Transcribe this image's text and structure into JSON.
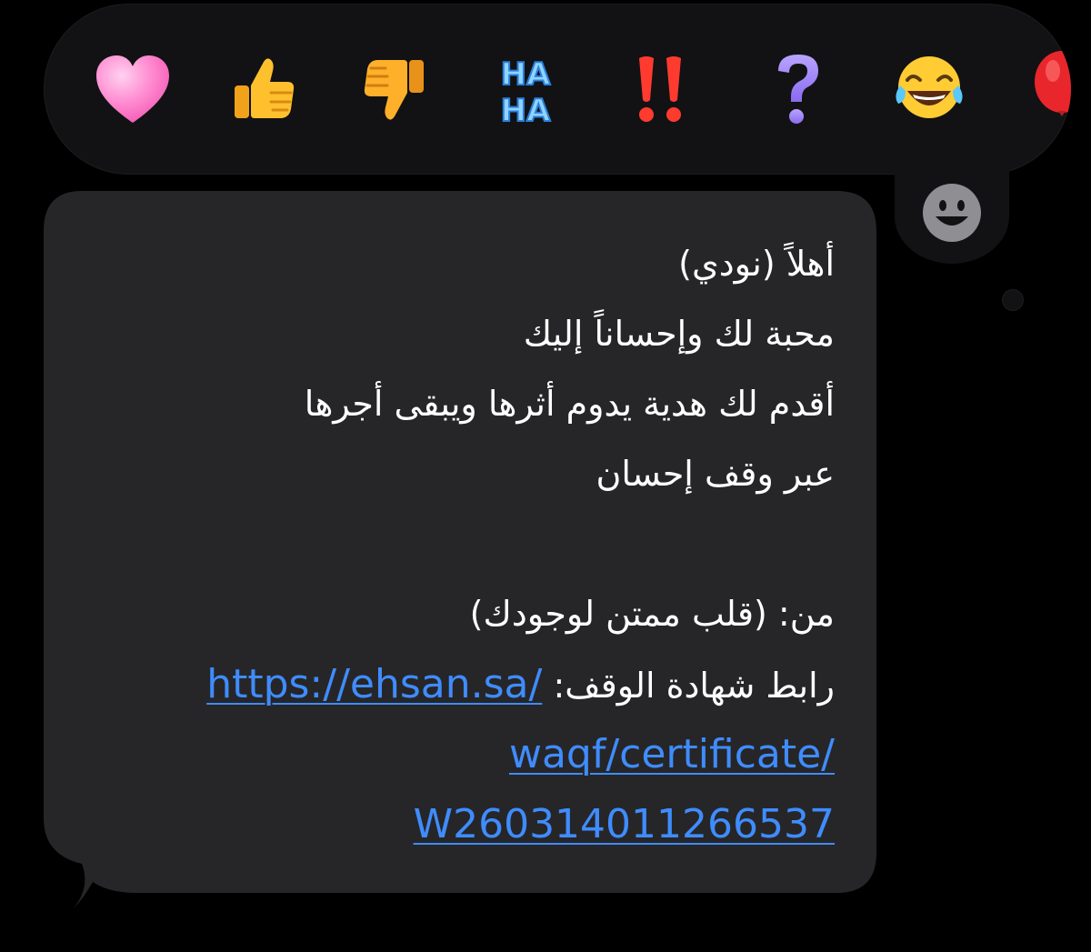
{
  "message": {
    "lines": [
      "أهلاً (نودي)",
      "محبة لك وإحساناً إليك",
      "أقدم لك هدية يدوم أثرها ويبقى أجرها",
      "عبر وقف إحسان",
      "",
      "من: (قلب ممتن لوجودك)"
    ],
    "link_label": "رابط شهادة الوقف:",
    "link_parts": [
      "https://ehsan.sa/",
      "waqf/certificate/",
      "W260314011266537"
    ]
  },
  "reactions": [
    {
      "name": "heart",
      "icon": "pink-heart-icon"
    },
    {
      "name": "like",
      "icon": "thumbs-up-icon"
    },
    {
      "name": "dislike",
      "icon": "thumbs-down-icon"
    },
    {
      "name": "haha",
      "icon": "haha-icon",
      "line1": "HA",
      "line2": "HA"
    },
    {
      "name": "emphasize",
      "icon": "double-exclamation-icon",
      "text": "‼"
    },
    {
      "name": "question",
      "icon": "question-mark-icon",
      "text": "?"
    },
    {
      "name": "laugh",
      "icon": "tears-of-joy-icon"
    },
    {
      "name": "balloon",
      "icon": "red-balloon-icon"
    }
  ],
  "colors": {
    "background": "#000000",
    "bubble": "#262628",
    "reaction_bar": "#121214",
    "link": "#3f8cff",
    "text": "#ffffff"
  }
}
